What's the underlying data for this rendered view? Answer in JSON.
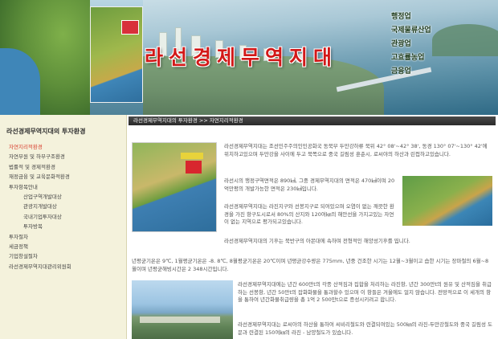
{
  "banner": {
    "title": "라선경제무역지대",
    "nav": [
      "행정업",
      "국제물류산업",
      "관광업",
      "고효률농업",
      "금융업"
    ]
  },
  "breadcrumb": "라선경제무역지대의 투자환경 >> 자연지리적환경",
  "sidebar": {
    "heading": "라선경제무역지대의 투자환경",
    "items": [
      {
        "label": "자연지리적환경",
        "level": 1,
        "active": true
      },
      {
        "label": "자연부원 및 하부구조환경",
        "level": 1,
        "active": false
      },
      {
        "label": "법률적 및 경제적환경",
        "level": 1,
        "active": false
      },
      {
        "label": "재정금융 및 교육문화적환경",
        "level": 1,
        "active": false
      },
      {
        "label": "투자항목안내",
        "level": 1,
        "active": false
      },
      {
        "label": "산업구역개발대상",
        "level": 2,
        "active": false
      },
      {
        "label": "관광지개발대상",
        "level": 2,
        "active": false
      },
      {
        "label": "국내기업투자대상",
        "level": 2,
        "active": false
      },
      {
        "label": "투자방복",
        "level": 2,
        "active": false
      },
      {
        "label": "투자절차",
        "level": 1,
        "active": false
      },
      {
        "label": "세금정책",
        "level": 1,
        "active": false
      },
      {
        "label": "기업창설절차",
        "level": 1,
        "active": false
      },
      {
        "label": "라선경제무역지대관리위원회",
        "level": 1,
        "active": false
      }
    ]
  },
  "content": {
    "p1": "라선경제무역지대는 조선민주주의인민공화국 동북부 두만강하류 북위 42° 08'~42° 38', 동경 130° 07'~130° 42'에 위치하고있으며 두만강을 사이에 두고 북쪽으로 중국 길림성 훈춘시, 로씨야의 하산과 린접하고있습니다.",
    "p2": "라선시의 행정구역면적은 890㎢, 그중 경제무역지대의 면적은 470㎢이며 20억만평의 개발가능한 면적은 230㎢입니다.",
    "p3": "라선경제무역지대는 라진지구와 선봉지구로 되여있으며 오염이 없는 깨끗한 환경을 가진 항구도시로서 80%의 산지와 120여㎞의 해안선을 가지고있는 자연이 없는 지역으로 평가되고있습니다.",
    "p4": "라선경제무역지대의 기후는 북반구의 아몬대에 속하며 전형적인 해양성기후를 띱니다.",
    "p5": "년평균기온은 9℃, 1월평균기온은 -8. 8℃, 8월평균기온은 20℃이며 년평균강수량은 775mm, 년중 건조한 시기는 12월~3월이고 습한 시기는 장마철의 6월~8월이며 년평균해빙시간은 2 348시간입니다.",
    "p6": "라선경제무역지대에는 년간 600만t의 각종 산적짐과 집합을 처리하는 라진항, 년간 300만t의 원유 및 산적짐을 취급하는 선봉항, 년간 50만t의 잡화화물을 통과할수 있으며 이 항들은 겨울에도 얼지 않습니다. 전망적으로 이 세개의 항을 통하여 년간화물취급량을 총 1억 2 500만t으로 증성시키려고 합니다.",
    "p7": "라선경제무역지대는 로씨아의 하산을 통하여 씨비리철도와 련결되여있는 500㎞의 라진-두만강철도와 중국 길림성 도문과 련결된 150여㎞의 라진 - 남양철도가 있습니다."
  },
  "colors": {
    "title_red": "#d21818",
    "sidebar_bg": "#f4f2dc",
    "active_item": "#d84030",
    "breadcrumb_bg": "#333333"
  },
  "icons": [
    "korea-map-image",
    "rason-region-map-image",
    "coastal-map-image",
    "port-photo-image",
    "city-aerial-image"
  ]
}
